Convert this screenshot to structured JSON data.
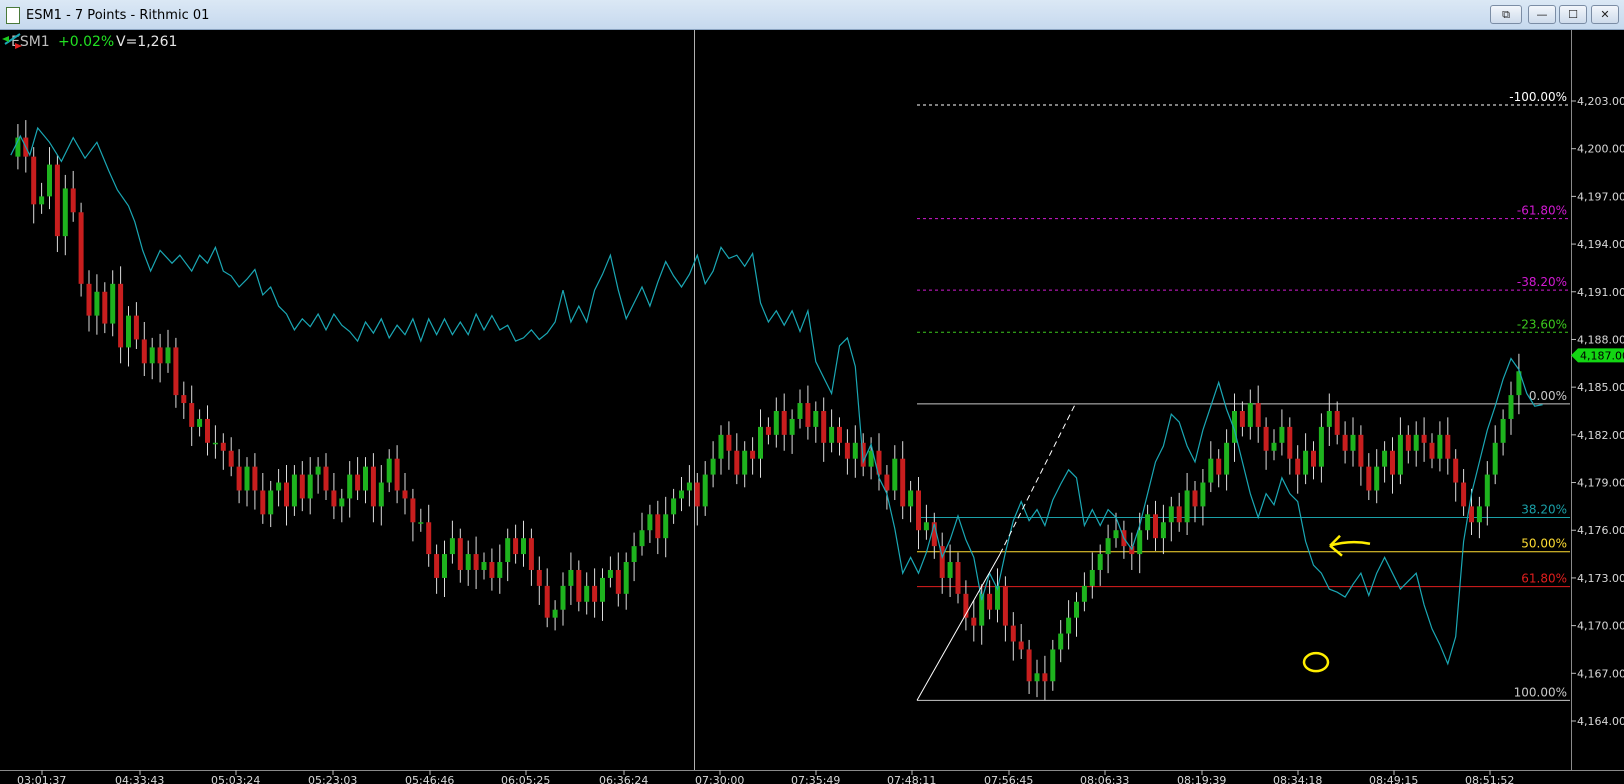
{
  "window": {
    "title": "ESM1 - 7 Points - Rithmic 01",
    "buttons": {
      "restore_doc": "⧉",
      "minimize": "—",
      "maximize": "☐",
      "close": "✕"
    }
  },
  "header": {
    "symbol": "ESM1",
    "change": "+0.02%",
    "volume": "V=1,261"
  },
  "icons": {
    "nav_arrows": "double-arrow-icon"
  },
  "colors": {
    "background": "#000000",
    "up_candle": "#1eb31e",
    "down_candle": "#c81e1e",
    "indicator_line": "#1aa7b4",
    "price_marker": "#13d613",
    "annotation": "#ffee00"
  },
  "chart_data": {
    "type": "candlestick",
    "title": "",
    "instrument": "ESM1",
    "bar_type": "7 Points",
    "ylim": [
      4162.5,
      4206.0
    ],
    "y_ticks": [
      "4,203.00",
      "4,200.00",
      "4,197.00",
      "4,194.00",
      "4,191.00",
      "4,188.00",
      "4,185.00",
      "4,182.00",
      "4,179.00",
      "4,176.00",
      "4,173.00",
      "4,170.00",
      "4,167.00",
      "4,164.00"
    ],
    "x_ticks": [
      "03:01:37",
      "04:33:43",
      "05:03:24",
      "05:23:03",
      "05:46:46",
      "06:05:25",
      "06:36:24",
      "07:30:00",
      "07:35:49",
      "07:48:11",
      "07:56:45",
      "08:06:33",
      "08:19:39",
      "08:34:18",
      "08:49:15",
      "08:51:52"
    ],
    "last_price": "4,187.00",
    "fibonacci_levels": [
      {
        "label": "-100.00%",
        "price": 4202.75,
        "color": "#ffffff",
        "style": "dashed"
      },
      {
        "label": "-61.80%",
        "price": 4195.6,
        "color": "#d21ad2",
        "style": "dashed"
      },
      {
        "label": "-38.20%",
        "price": 4191.1,
        "color": "#d21ad2",
        "style": "dashed"
      },
      {
        "label": "-23.60%",
        "price": 4188.45,
        "color": "#3cc81e",
        "style": "dashed"
      },
      {
        "label": "0.00%",
        "price": 4183.95,
        "color": "#c8c8c8",
        "style": "solid"
      },
      {
        "label": "38.20%",
        "price": 4176.8,
        "color": "#1aa0a8",
        "style": "solid"
      },
      {
        "label": "50.00%",
        "price": 4174.65,
        "color": "#ffdd33",
        "style": "solid"
      },
      {
        "label": "61.80%",
        "price": 4172.45,
        "color": "#e01e1e",
        "style": "solid"
      },
      {
        "label": "100.00%",
        "price": 4165.3,
        "color": "#c8c8c8",
        "style": "solid"
      }
    ],
    "indicator_series": [
      [
        0.1,
        4199.6
      ],
      [
        1.3,
        4200.8
      ],
      [
        2.5,
        4199.6
      ],
      [
        3.5,
        4201.3
      ],
      [
        5,
        4200.4
      ],
      [
        6.5,
        4199.2
      ],
      [
        8,
        4200.7
      ],
      [
        9.5,
        4199.4
      ],
      [
        11,
        4200.4
      ],
      [
        12.5,
        4198.6
      ],
      [
        13.6,
        4197.4
      ],
      [
        15,
        4196.4
      ],
      [
        15.8,
        4195.4
      ],
      [
        16.8,
        4193.6
      ],
      [
        17.8,
        4192.3
      ],
      [
        19,
        4193.6
      ],
      [
        20.5,
        4192.8
      ],
      [
        21.5,
        4193.3
      ],
      [
        23,
        4192.3
      ],
      [
        24,
        4193.3
      ],
      [
        25,
        4192.8
      ],
      [
        26,
        4193.8
      ],
      [
        27,
        4192.3
      ],
      [
        28,
        4192.0
      ],
      [
        29,
        4191.3
      ],
      [
        30,
        4191.8
      ],
      [
        31,
        4192.4
      ],
      [
        32,
        4190.8
      ],
      [
        33,
        4191.3
      ],
      [
        34,
        4190.1
      ],
      [
        35,
        4189.6
      ],
      [
        36,
        4188.6
      ],
      [
        37,
        4189.3
      ],
      [
        38,
        4188.8
      ],
      [
        39,
        4189.6
      ],
      [
        40,
        4188.6
      ],
      [
        41,
        4189.6
      ],
      [
        42,
        4188.9
      ],
      [
        43,
        4188.5
      ],
      [
        44,
        4187.9
      ],
      [
        45,
        4189.1
      ],
      [
        46,
        4188.4
      ],
      [
        47,
        4189.3
      ],
      [
        48,
        4188.1
      ],
      [
        49,
        4188.9
      ],
      [
        50,
        4188.3
      ],
      [
        51,
        4189.3
      ],
      [
        52,
        4187.9
      ],
      [
        53,
        4189.3
      ],
      [
        54,
        4188.3
      ],
      [
        55,
        4189.3
      ],
      [
        56,
        4188.3
      ],
      [
        57,
        4189.1
      ],
      [
        58,
        4188.3
      ],
      [
        59,
        4189.6
      ],
      [
        60,
        4188.6
      ],
      [
        61,
        4189.5
      ],
      [
        62,
        4188.6
      ],
      [
        63,
        4188.9
      ],
      [
        64,
        4187.9
      ],
      [
        65,
        4188.1
      ],
      [
        66,
        4188.6
      ],
      [
        67,
        4188.0
      ],
      [
        68,
        4188.4
      ],
      [
        69,
        4189.1
      ],
      [
        70,
        4191.1
      ],
      [
        71,
        4189.1
      ],
      [
        72,
        4190.1
      ],
      [
        73,
        4189.1
      ],
      [
        74,
        4191.1
      ],
      [
        75,
        4192.1
      ],
      [
        76,
        4193.3
      ],
      [
        77,
        4191.1
      ],
      [
        78,
        4189.3
      ],
      [
        79,
        4190.3
      ],
      [
        80,
        4191.3
      ],
      [
        81,
        4190.1
      ],
      [
        82,
        4191.6
      ],
      [
        83,
        4192.9
      ],
      [
        84,
        4192.0
      ],
      [
        85,
        4191.3
      ],
      [
        86,
        4192.1
      ],
      [
        87,
        4193.3
      ],
      [
        88,
        4191.5
      ],
      [
        89,
        4192.3
      ],
      [
        90,
        4193.8
      ],
      [
        91,
        4193.1
      ],
      [
        92,
        4193.3
      ],
      [
        93,
        4192.6
      ],
      [
        94,
        4193.4
      ],
      [
        95,
        4190.3
      ],
      [
        96,
        4189.1
      ],
      [
        97,
        4189.8
      ],
      [
        98,
        4188.9
      ],
      [
        99,
        4189.8
      ],
      [
        100,
        4188.5
      ],
      [
        101,
        4189.8
      ],
      [
        102,
        4186.6
      ],
      [
        103,
        4185.6
      ],
      [
        104,
        4184.6
      ],
      [
        105,
        4187.6
      ],
      [
        106,
        4188.1
      ],
      [
        107,
        4186.3
      ],
      [
        108,
        4180.3
      ],
      [
        109,
        4181.4
      ],
      [
        110,
        4179.3
      ],
      [
        111,
        4178.3
      ],
      [
        112,
        4176.1
      ],
      [
        113,
        4173.3
      ],
      [
        114,
        4174.3
      ],
      [
        115,
        4173.3
      ],
      [
        116,
        4174.6
      ],
      [
        117,
        4176.4
      ],
      [
        118,
        4174.3
      ],
      [
        119,
        4175.4
      ],
      [
        120,
        4176.9
      ],
      [
        121,
        4175.4
      ],
      [
        122,
        4174.3
      ],
      [
        123,
        4171.6
      ],
      [
        124,
        4173.3
      ],
      [
        125,
        4172.3
      ],
      [
        126,
        4174.6
      ],
      [
        127,
        4176.6
      ],
      [
        128,
        4177.8
      ],
      [
        129,
        4176.6
      ],
      [
        130,
        4177.3
      ],
      [
        131,
        4176.3
      ],
      [
        132,
        4177.9
      ],
      [
        133,
        4178.9
      ],
      [
        134,
        4179.8
      ],
      [
        135,
        4179.3
      ],
      [
        136,
        4176.3
      ],
      [
        137,
        4177.3
      ],
      [
        138,
        4176.3
      ],
      [
        139,
        4177.3
      ],
      [
        140,
        4176.8
      ],
      [
        141,
        4175.5
      ],
      [
        142,
        4174.8
      ],
      [
        143,
        4176.3
      ],
      [
        144,
        4178.3
      ],
      [
        145,
        4180.3
      ],
      [
        146,
        4181.3
      ],
      [
        147,
        4183.3
      ],
      [
        148,
        4182.8
      ],
      [
        149,
        4181.3
      ],
      [
        150,
        4180.3
      ],
      [
        151,
        4182.3
      ],
      [
        152,
        4183.8
      ],
      [
        153,
        4185.3
      ],
      [
        154,
        4183.6
      ],
      [
        155,
        4182.3
      ],
      [
        156,
        4180.3
      ],
      [
        157,
        4178.3
      ],
      [
        158,
        4176.8
      ],
      [
        159,
        4178.3
      ],
      [
        160,
        4177.6
      ],
      [
        161,
        4179.3
      ],
      [
        162,
        4178.3
      ],
      [
        163,
        4177.8
      ],
      [
        164,
        4175.3
      ],
      [
        165,
        4173.8
      ],
      [
        166,
        4173.3
      ],
      [
        167,
        4172.3
      ],
      [
        168,
        4172.1
      ],
      [
        169,
        4171.8
      ],
      [
        170,
        4172.6
      ],
      [
        171,
        4173.3
      ],
      [
        172,
        4171.9
      ],
      [
        173,
        4173.3
      ],
      [
        174,
        4174.3
      ],
      [
        175,
        4173.3
      ],
      [
        176,
        4172.3
      ],
      [
        177,
        4172.8
      ],
      [
        178,
        4173.3
      ],
      [
        179,
        4171.3
      ],
      [
        180,
        4169.8
      ],
      [
        181,
        4168.8
      ],
      [
        182,
        4167.6
      ],
      [
        183,
        4169.3
      ],
      [
        184,
        4175.3
      ],
      [
        185,
        4178.3
      ],
      [
        186,
        4180.3
      ],
      [
        187,
        4182.3
      ],
      [
        188,
        4183.8
      ],
      [
        189,
        4185.5
      ],
      [
        190,
        4186.8
      ],
      [
        191,
        4186.1
      ],
      [
        192,
        4184.6
      ],
      [
        193,
        4183.8
      ],
      [
        194,
        4183.9
      ]
    ]
  }
}
